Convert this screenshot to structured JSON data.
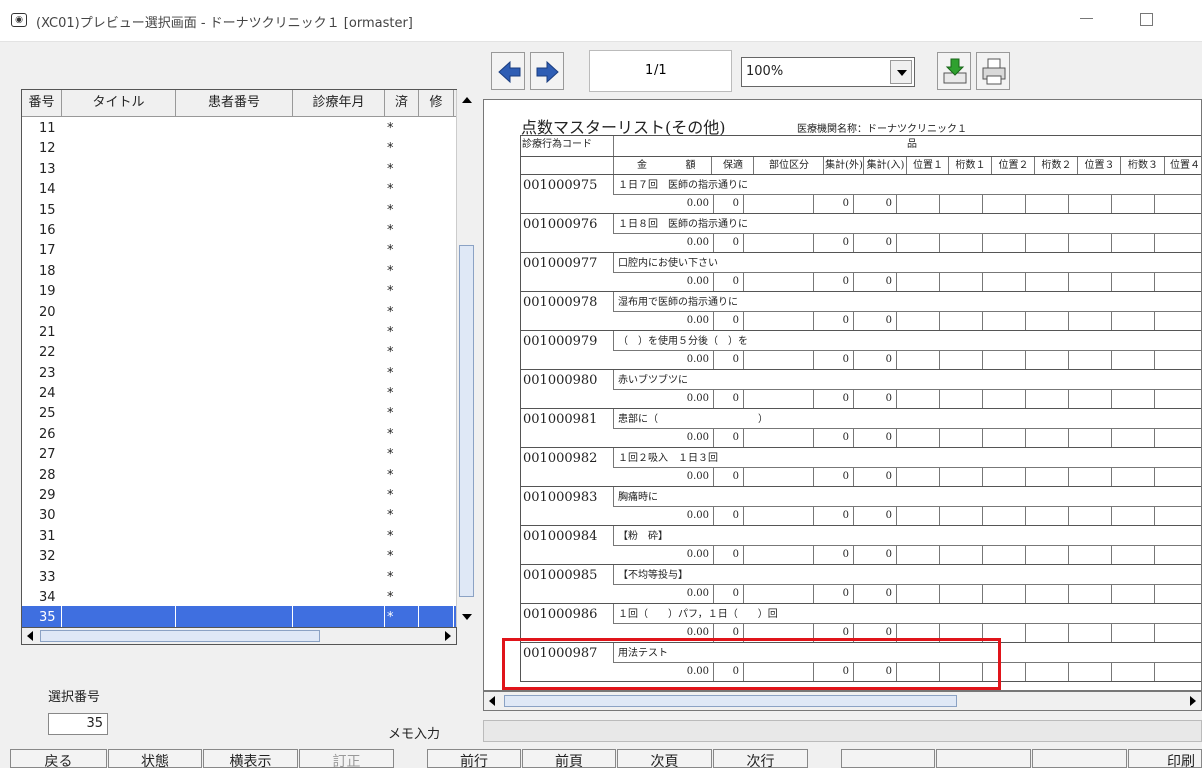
{
  "window": {
    "title": "(XC01)プレビュー選択画面 - ドーナツクリニック１ [ormaster]"
  },
  "list": {
    "headers": [
      "番号",
      "タイトル",
      "患者番号",
      "診療年月",
      "済",
      "修"
    ],
    "rows": [
      {
        "no": "11",
        "done": "*"
      },
      {
        "no": "12",
        "done": "*"
      },
      {
        "no": "13",
        "done": "*"
      },
      {
        "no": "14",
        "done": "*"
      },
      {
        "no": "15",
        "done": "*"
      },
      {
        "no": "16",
        "done": "*"
      },
      {
        "no": "17",
        "done": "*"
      },
      {
        "no": "18",
        "done": "*"
      },
      {
        "no": "19",
        "done": "*"
      },
      {
        "no": "20",
        "done": "*"
      },
      {
        "no": "21",
        "done": "*"
      },
      {
        "no": "22",
        "done": "*"
      },
      {
        "no": "23",
        "done": "*"
      },
      {
        "no": "24",
        "done": "*"
      },
      {
        "no": "25",
        "done": "*"
      },
      {
        "no": "26",
        "done": "*"
      },
      {
        "no": "27",
        "done": "*"
      },
      {
        "no": "28",
        "done": "*"
      },
      {
        "no": "29",
        "done": "*"
      },
      {
        "no": "30",
        "done": "*"
      },
      {
        "no": "31",
        "done": "*"
      },
      {
        "no": "32",
        "done": "*"
      },
      {
        "no": "33",
        "done": "*"
      },
      {
        "no": "34",
        "done": "*"
      },
      {
        "no": "35",
        "done": "*"
      }
    ],
    "selected_no": "35"
  },
  "selection": {
    "label": "選択番号",
    "value": "35"
  },
  "memo": {
    "label": "メモ入力",
    "value": ""
  },
  "toolbar": {
    "page_current": "1",
    "page_total": "/1",
    "zoom": "100%"
  },
  "document": {
    "title": "点数マスターリスト(その他)",
    "institution": "医療機関名称：ドーナツクリニック１",
    "header_code": "診療行為コード",
    "header_item": "品",
    "columns": [
      "金",
      "額",
      "保適",
      "部位区分",
      "集計(外)",
      "集計(入)",
      "位置１",
      "桁数１",
      "位置２",
      "桁数２",
      "位置３",
      "桁数３",
      "位置４"
    ],
    "records": [
      {
        "code": "001000975",
        "name": "１日７回　医師の指示通りに",
        "amount": "0.00",
        "hoteki": "0",
        "sum_out": "0",
        "sum_in": "0"
      },
      {
        "code": "001000976",
        "name": "１日８回　医師の指示通りに",
        "amount": "0.00",
        "hoteki": "0",
        "sum_out": "0",
        "sum_in": "0"
      },
      {
        "code": "001000977",
        "name": "口腔内にお使い下さい",
        "amount": "0.00",
        "hoteki": "0",
        "sum_out": "0",
        "sum_in": "0"
      },
      {
        "code": "001000978",
        "name": "湿布用で医師の指示通りに",
        "amount": "0.00",
        "hoteki": "0",
        "sum_out": "0",
        "sum_in": "0"
      },
      {
        "code": "001000979",
        "name": "（　）を使用５分後（　）を",
        "amount": "0.00",
        "hoteki": "0",
        "sum_out": "0",
        "sum_in": "0"
      },
      {
        "code": "001000980",
        "name": "赤いブツブツに",
        "amount": "0.00",
        "hoteki": "0",
        "sum_out": "0",
        "sum_in": "0"
      },
      {
        "code": "001000981",
        "name": "患部に（　　　　　　　　　　）",
        "amount": "0.00",
        "hoteki": "0",
        "sum_out": "0",
        "sum_in": "0"
      },
      {
        "code": "001000982",
        "name": "１回２吸入　１日３回",
        "amount": "0.00",
        "hoteki": "0",
        "sum_out": "0",
        "sum_in": "0"
      },
      {
        "code": "001000983",
        "name": "胸痛時に",
        "amount": "0.00",
        "hoteki": "0",
        "sum_out": "0",
        "sum_in": "0"
      },
      {
        "code": "001000984",
        "name": "【粉　砕】",
        "amount": "0.00",
        "hoteki": "0",
        "sum_out": "0",
        "sum_in": "0"
      },
      {
        "code": "001000985",
        "name": "【不均等投与】",
        "amount": "0.00",
        "hoteki": "0",
        "sum_out": "0",
        "sum_in": "0"
      },
      {
        "code": "001000986",
        "name": "１回（　　）パフ，１日（　　）回",
        "amount": "0.00",
        "hoteki": "0",
        "sum_out": "0",
        "sum_in": "0"
      },
      {
        "code": "001000987",
        "name": "用法テスト",
        "amount": "0.00",
        "hoteki": "0",
        "sum_out": "0",
        "sum_in": "0"
      }
    ]
  },
  "buttons": {
    "back": "戻る",
    "status": "状態",
    "landscape": "横表示",
    "correct": "訂正",
    "prev_line": "前行",
    "prev_page": "前頁",
    "next_page": "次頁",
    "next_line": "次行",
    "print": "印刷"
  },
  "colors": {
    "selected_row": "#3f6fe0",
    "highlight": "#e0141a"
  }
}
